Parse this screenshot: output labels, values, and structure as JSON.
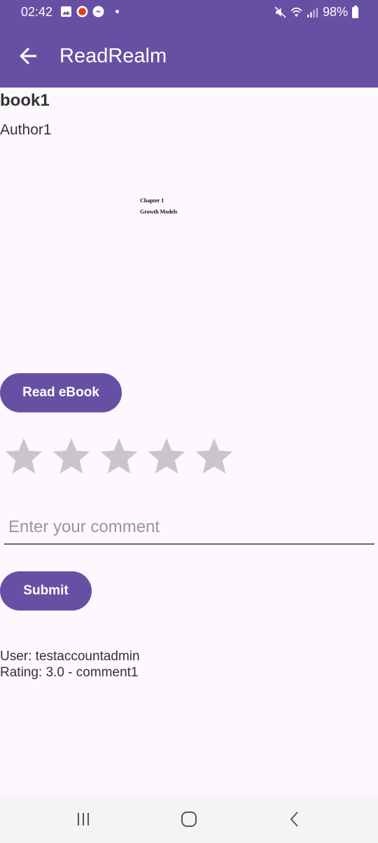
{
  "status_bar": {
    "time": "02:42",
    "battery": "98%",
    "icons": [
      "gallery-icon",
      "app-notification-icon",
      "messenger-icon",
      "mute-icon",
      "wifi-icon",
      "signal-icon",
      "battery-icon"
    ]
  },
  "app_bar": {
    "title": "ReadRealm",
    "back_icon": "arrow-left-icon"
  },
  "book": {
    "title": "book1",
    "author": "Author1",
    "preview": {
      "chapter_number": "Chapter 1",
      "chapter_title": "Growth Models"
    }
  },
  "actions": {
    "read_label": "Read eBook",
    "submit_label": "Submit"
  },
  "rating": {
    "max": 5,
    "selected": 0,
    "star_color": "#cac4cf"
  },
  "comment": {
    "placeholder": "Enter your comment",
    "value": ""
  },
  "reviews": [
    {
      "user_line": "User: testaccountadmin",
      "rating_line": "Rating: 3.0 - comment1"
    }
  ],
  "colors": {
    "primary": "#6750a4",
    "background": "#fdf7fe"
  },
  "nav": {
    "icons": [
      "recent-apps-icon",
      "home-icon",
      "back-icon"
    ]
  }
}
